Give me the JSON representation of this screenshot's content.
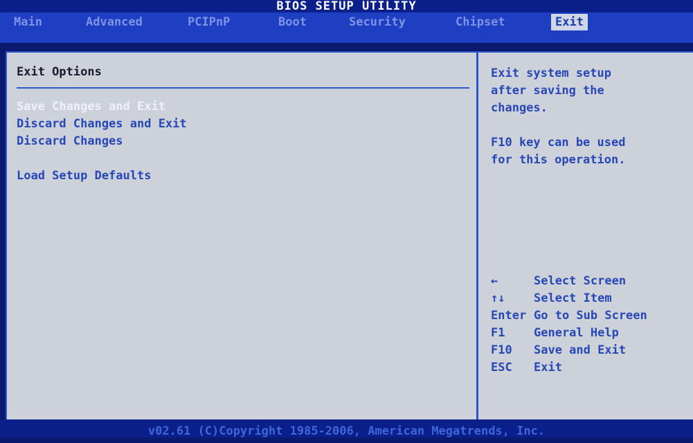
{
  "title": "BIOS SETUP UTILITY",
  "tabs": [
    {
      "label": "Main",
      "active": false
    },
    {
      "label": "Advanced",
      "active": false
    },
    {
      "label": "PCIPnP",
      "active": false
    },
    {
      "label": "Boot",
      "active": false
    },
    {
      "label": "Security",
      "active": false
    },
    {
      "label": "Chipset",
      "active": false
    },
    {
      "label": "Exit",
      "active": true
    }
  ],
  "main": {
    "section_title": "Exit Options",
    "items": [
      {
        "label": "Save Changes and Exit",
        "selected": true
      },
      {
        "label": "Discard Changes and Exit",
        "selected": false
      },
      {
        "label": "Discard Changes",
        "selected": false
      },
      {
        "label": "Load Setup Defaults",
        "selected": false
      }
    ]
  },
  "help": {
    "text": "Exit system setup\nafter saving the\nchanges.\n\nF10 key can be used\nfor this operation.",
    "keys": [
      {
        "key": "←",
        "desc": "Select Screen"
      },
      {
        "key": "↑↓",
        "desc": "Select Item"
      },
      {
        "key": "Enter",
        "desc": "Go to Sub Screen"
      },
      {
        "key": "F1",
        "desc": "General Help"
      },
      {
        "key": "F10",
        "desc": "Save and Exit"
      },
      {
        "key": "ESC",
        "desc": "Exit"
      }
    ]
  },
  "footer": "v02.61 (C)Copyright 1985-2006, American Megatrends, Inc.",
  "colors": {
    "background": "#0a1a6e",
    "menu_bar": "#1f3fc2",
    "panel": "#cdd2da",
    "item_text": "#2747b6",
    "selected_text": "#eef1f8"
  }
}
